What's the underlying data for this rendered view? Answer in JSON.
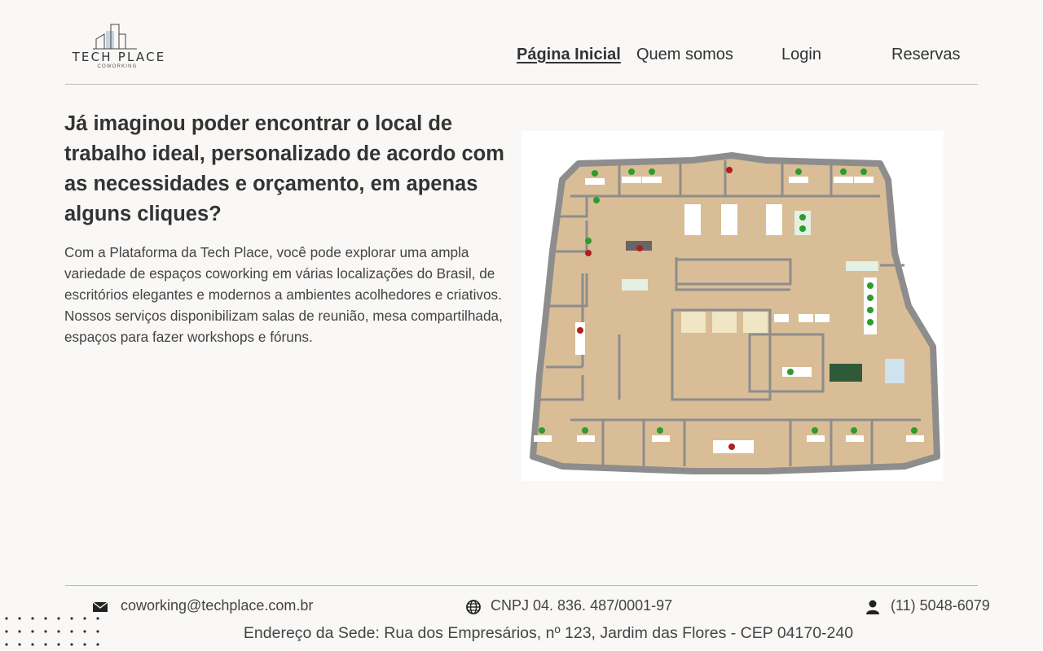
{
  "brand": {
    "name": "TECH PLACE",
    "tagline": "COWORKING"
  },
  "nav": {
    "items": [
      {
        "label": "Página Inicial",
        "active": true
      },
      {
        "label": "Quem somos",
        "active": false
      },
      {
        "label": "Login",
        "active": false
      },
      {
        "label": "Reservas",
        "active": false
      }
    ]
  },
  "hero": {
    "headline": "Já imaginou poder encontrar o local de trabalho ideal, personalizado de acordo com as necessidades e orçamento, em apenas alguns cliques?",
    "body": "Com a Plataforma da Tech Place, você pode explorar uma ampla variedade de espaços coworking em várias localizações do Brasil, de escritórios elegantes e modernos a ambientes acolhedores e criativos. Nossos serviços disponibilizam salas de reunião, mesa compartilhada, espaços para fazer workshops e fóruns."
  },
  "footer": {
    "email": "coworking@techplace.com.br",
    "cnpj": "CNPJ 04. 836. 487/0001-97",
    "phone": "(11) 5048-6079",
    "address": "Endereço da Sede: Rua dos Empresários, nº 123, Jardim das Flores - CEP 04170-240",
    "icons": [
      "envelope-icon",
      "globe-icon",
      "user-icon"
    ]
  },
  "colors": {
    "background": "#f9f8f6",
    "divider": "#c9b4a8",
    "text": "#333333",
    "floor_wood": "#d9bd96",
    "wall_gray": "#8d8d8d"
  }
}
